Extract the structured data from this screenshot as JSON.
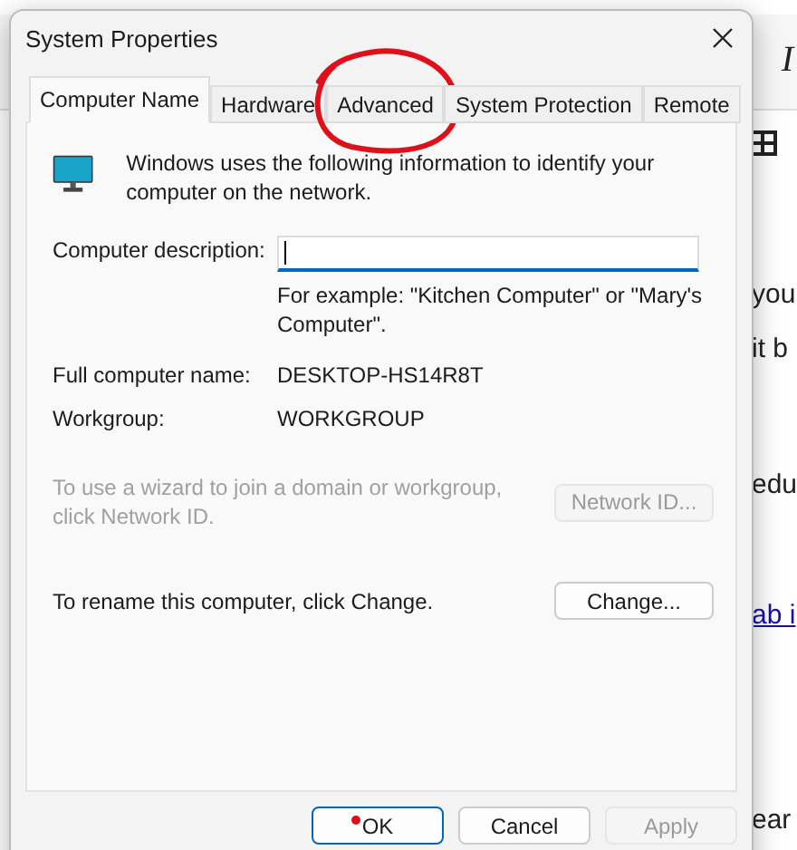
{
  "background_app": {
    "toolbar": {
      "italic_button": "I"
    },
    "document_fragments": [
      {
        "text": "you",
        "kind": "text"
      },
      {
        "text": "it b",
        "kind": "text"
      },
      {
        "text": "edu",
        "kind": "text"
      },
      {
        "text": "ab i",
        "kind": "link"
      },
      {
        "text": "ear",
        "kind": "text"
      }
    ]
  },
  "dialog": {
    "title": "System Properties",
    "tabs": [
      {
        "label": "Computer Name",
        "selected": true,
        "annotated": false
      },
      {
        "label": "Hardware",
        "selected": false,
        "annotated": false
      },
      {
        "label": "Advanced",
        "selected": false,
        "annotated": true
      },
      {
        "label": "System Protection",
        "selected": false,
        "annotated": false
      },
      {
        "label": "Remote",
        "selected": false,
        "annotated": false
      }
    ],
    "intro": "Windows uses the following information to identify your computer on the network.",
    "description": {
      "label": "Computer description:",
      "focused": true,
      "hint": "For example: \"Kitchen Computer\" or \"Mary's Computer\"."
    },
    "info_rows": [
      {
        "label": "Full computer name:",
        "value": "DESKTOP-HS14R8T"
      },
      {
        "label": "Workgroup:",
        "value": "WORKGROUP"
      }
    ],
    "actions": [
      {
        "text": "To use a wizard to join a domain or workgroup, click Network ID.",
        "button": "Network ID...",
        "disabled": true
      },
      {
        "text": "To rename this computer, click Change.",
        "button": "Change...",
        "disabled": false
      }
    ],
    "buttons": [
      {
        "label": "OK",
        "default": true,
        "marked": true,
        "disabled": false
      },
      {
        "label": "Cancel",
        "default": false,
        "marked": false,
        "disabled": false
      },
      {
        "label": "Apply",
        "default": false,
        "marked": false,
        "disabled": true
      }
    ]
  }
}
